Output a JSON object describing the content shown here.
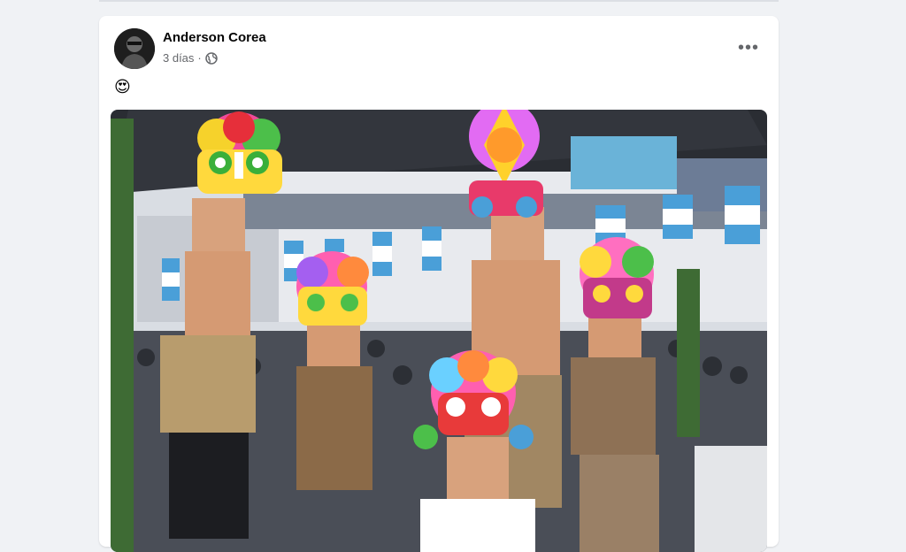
{
  "post": {
    "author": "Anderson Corea",
    "time": "3 días",
    "separator": "·",
    "privacy_icon": "globe-icon",
    "more_label": "•••",
    "text": "😍",
    "photo_icon": "photo"
  },
  "colors": {
    "page_bg": "#f0f2f5",
    "card_bg": "#ffffff",
    "primary_text": "#050505",
    "secondary_text": "#65676b",
    "flag_blue": "#4a9fd8"
  }
}
